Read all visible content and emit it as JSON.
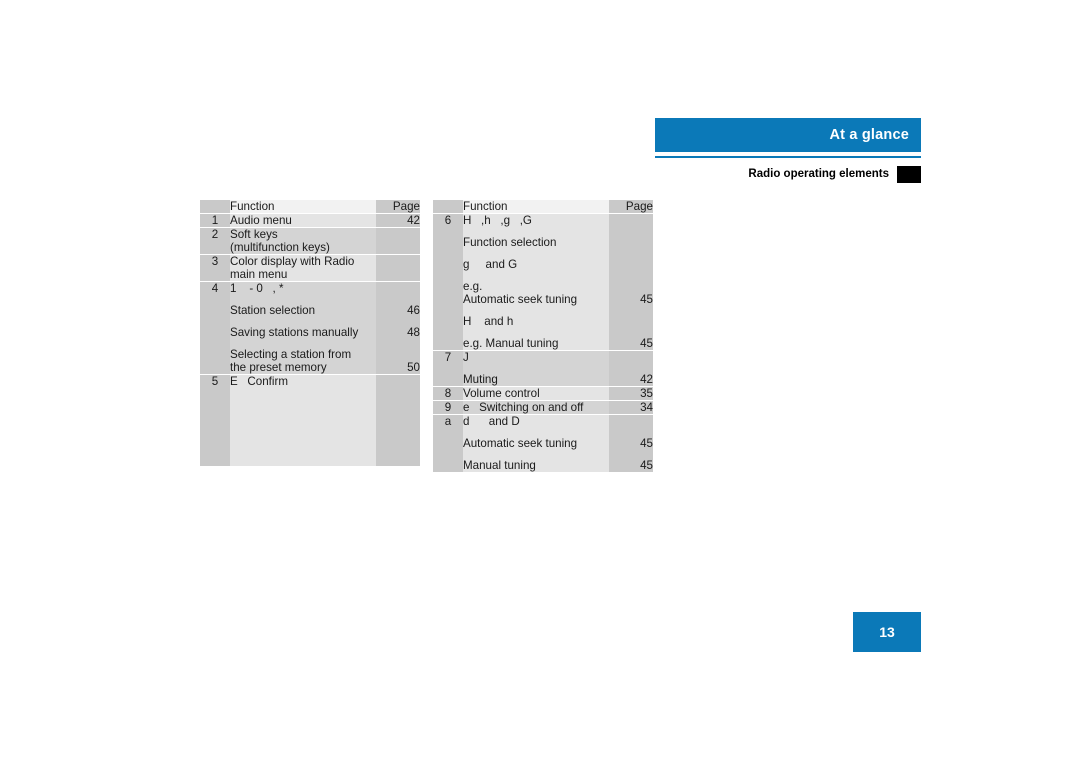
{
  "header": {
    "title": "At a glance",
    "subtitle": "Radio operating elements",
    "accent_color": "#0b79b8",
    "square_color": "#000000"
  },
  "page_badge": {
    "number": "13"
  },
  "tables": {
    "left": {
      "columns": {
        "num": "",
        "function": "Function",
        "page": "Page"
      },
      "rows": [
        {
          "num": "1",
          "lines": [
            {
              "text": "Audio menu",
              "page": "42"
            }
          ]
        },
        {
          "num": "2",
          "lines": [
            {
              "text": "Soft keys",
              "page": ""
            },
            {
              "text": "(multifunction keys)",
              "page": ""
            }
          ]
        },
        {
          "num": "3",
          "lines": [
            {
              "text": "Color display with Radio",
              "page": ""
            },
            {
              "text": "main menu",
              "page": ""
            }
          ]
        },
        {
          "num": "4",
          "lines": [
            {
              "text": "1    - 0   , *",
              "page": "",
              "gap": false
            },
            {
              "text": "Station selection",
              "page": "46",
              "gap": true
            },
            {
              "text": "Saving stations manually",
              "page": "48",
              "gap": true
            },
            {
              "text": "Selecting a station from",
              "page": "",
              "gap": true
            },
            {
              "text": "the preset memory",
              "page": "50",
              "gap": false
            }
          ]
        },
        {
          "num": "5",
          "lines": [
            {
              "text": "E   Confirm",
              "page": ""
            }
          ],
          "filler_height": 78
        }
      ]
    },
    "right": {
      "columns": {
        "num": "",
        "function": "Function",
        "page": "Page"
      },
      "rows": [
        {
          "num": "6",
          "lines": [
            {
              "text": "H   ,h   ,g   ,G",
              "page": "",
              "gap": false
            },
            {
              "text": "Function selection",
              "page": "",
              "gap": true
            },
            {
              "text": "g     and G",
              "page": "",
              "gap": true
            },
            {
              "text": "e.g.",
              "page": "",
              "gap": true
            },
            {
              "text": "Automatic seek tuning",
              "page": "45",
              "gap": false
            },
            {
              "text": "H    and h",
              "page": "",
              "gap": true
            },
            {
              "text": "e.g. Manual tuning",
              "page": "45",
              "gap": true
            }
          ]
        },
        {
          "num": "7",
          "lines": [
            {
              "text": "J",
              "page": "",
              "gap": false
            },
            {
              "text": "Muting",
              "page": "42",
              "gap": true
            }
          ]
        },
        {
          "num": "8",
          "lines": [
            {
              "text": "Volume control",
              "page": "35"
            }
          ]
        },
        {
          "num": "9",
          "lines": [
            {
              "text": "e   Switching on and off",
              "page": "34"
            }
          ]
        },
        {
          "num": "a",
          "lines": [
            {
              "text": "d      and D",
              "page": "",
              "gap": false
            },
            {
              "text": "Automatic seek tuning",
              "page": "45",
              "gap": true
            },
            {
              "text": "Manual tuning",
              "page": "45",
              "gap": true
            }
          ]
        }
      ]
    }
  }
}
